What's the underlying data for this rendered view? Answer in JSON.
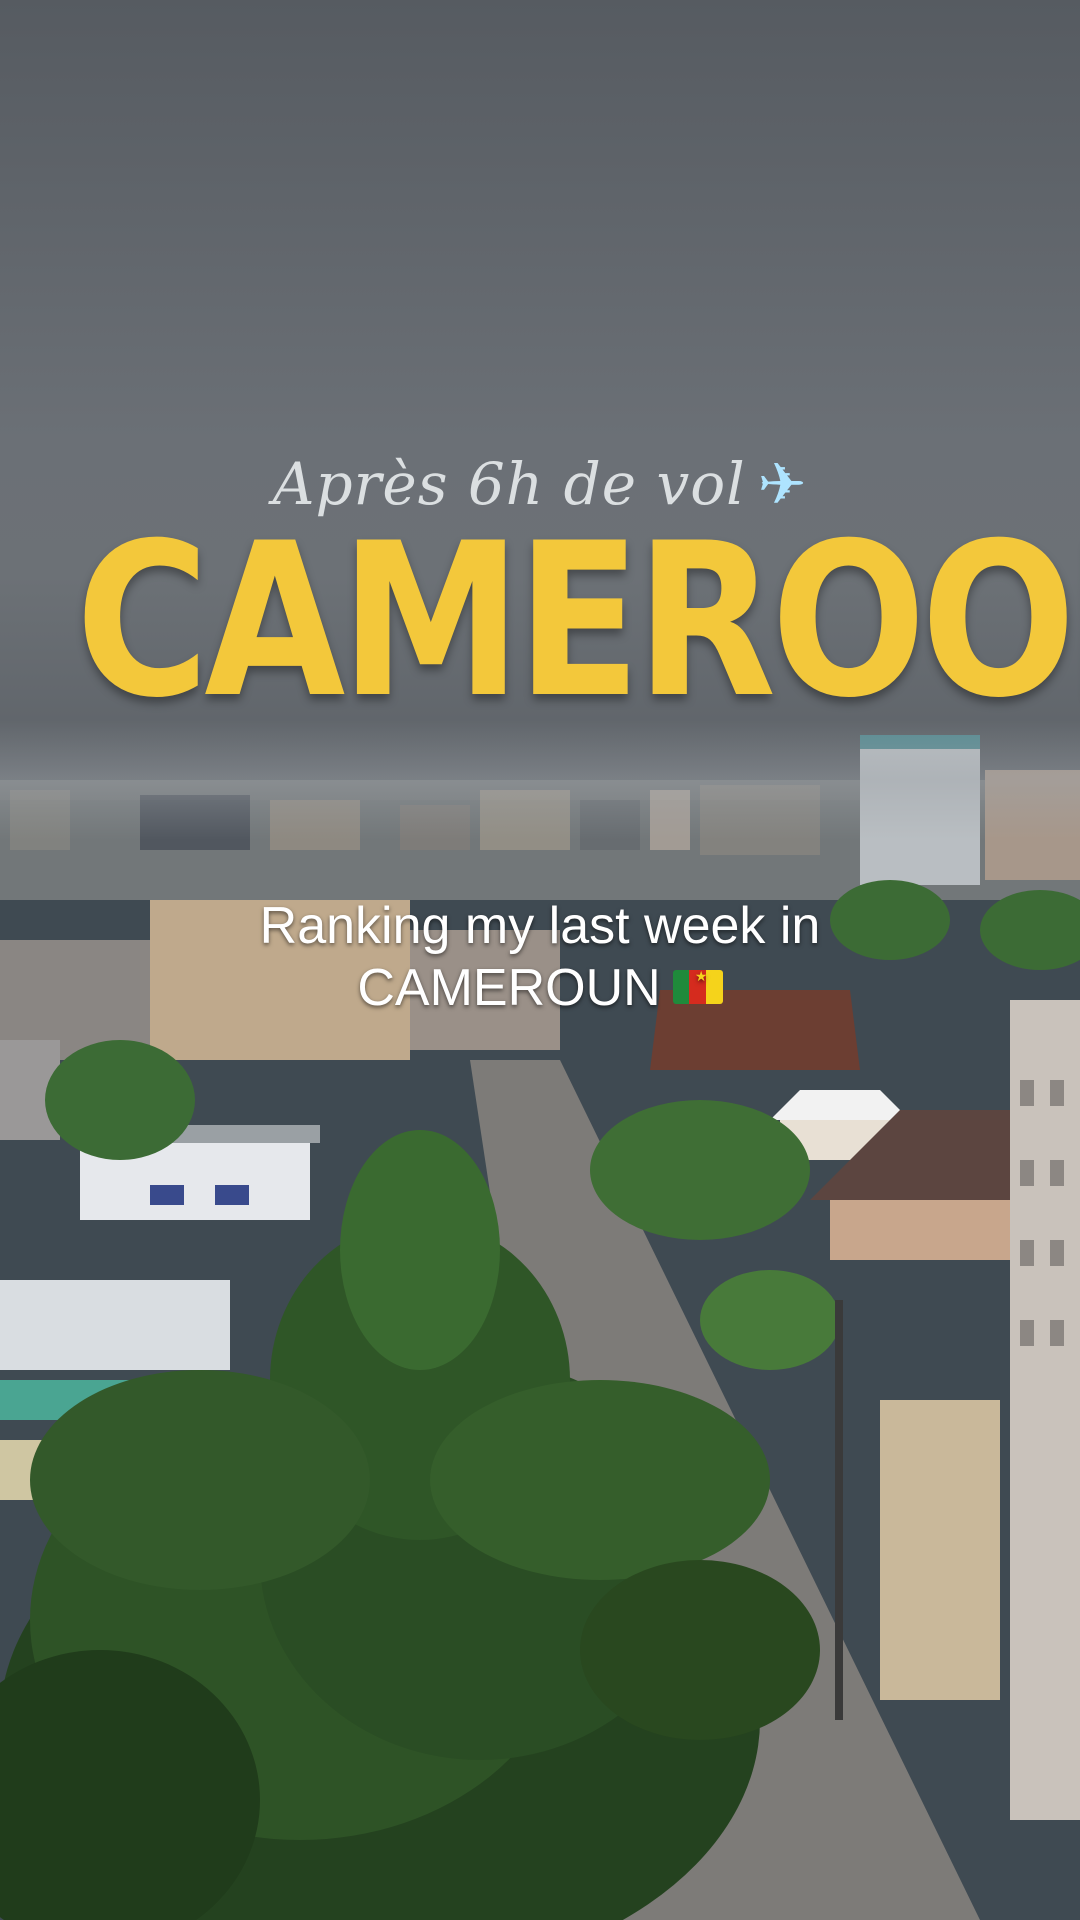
{
  "overlay": {
    "script_line": "Après 6h de vol",
    "plane_icon": "airplane-icon",
    "title": "CAMEROON",
    "caption_line1": "Ranking my last week in",
    "caption_line2": "CAMEROUN",
    "flag_icon": "cameroon-flag-icon"
  },
  "colors": {
    "title": "#f3c83b",
    "caption": "#ffffff",
    "sky": "#61666c"
  }
}
